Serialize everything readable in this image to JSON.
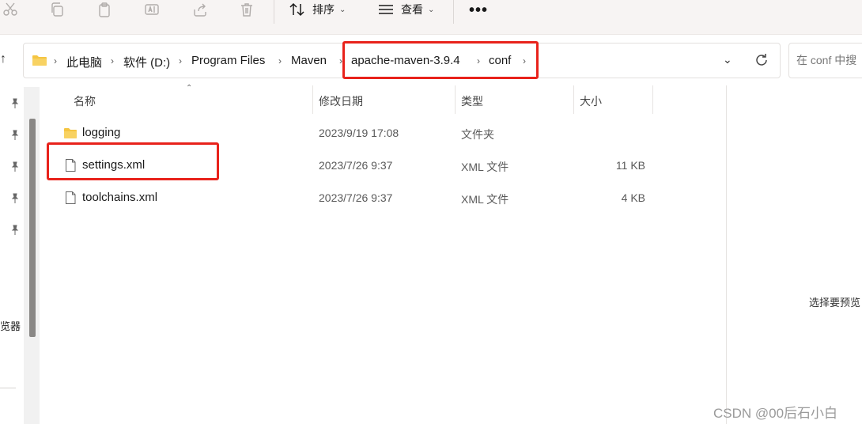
{
  "toolbar": {
    "sort_label": "排序",
    "view_label": "查看"
  },
  "address": {
    "breadcrumbs": [
      "此电脑",
      "软件 (D:)",
      "Program Files",
      "Maven",
      "apache-maven-3.9.4",
      "conf"
    ],
    "search_placeholder": "在 conf 中搜"
  },
  "columns": {
    "name": "名称",
    "modified": "修改日期",
    "type": "类型",
    "size": "大小"
  },
  "files": [
    {
      "name": "logging",
      "modified": "2023/9/19 17:08",
      "type": "文件夹",
      "size": "",
      "icon": "folder-icon"
    },
    {
      "name": "settings.xml",
      "modified": "2023/7/26 9:37",
      "type": "XML 文件",
      "size": "11 KB",
      "icon": "file-icon"
    },
    {
      "name": "toolchains.xml",
      "modified": "2023/7/26 9:37",
      "type": "XML 文件",
      "size": "4 KB",
      "icon": "file-icon"
    }
  ],
  "sidebar": {
    "partial_label": "览器"
  },
  "preview": {
    "hint": "选择要预览"
  },
  "watermark": "CSDN @00后石小白",
  "colors": {
    "highlight_box": "#e8221b",
    "folder": "#f5c542",
    "toolbar_bg": "#f7f4f3"
  }
}
